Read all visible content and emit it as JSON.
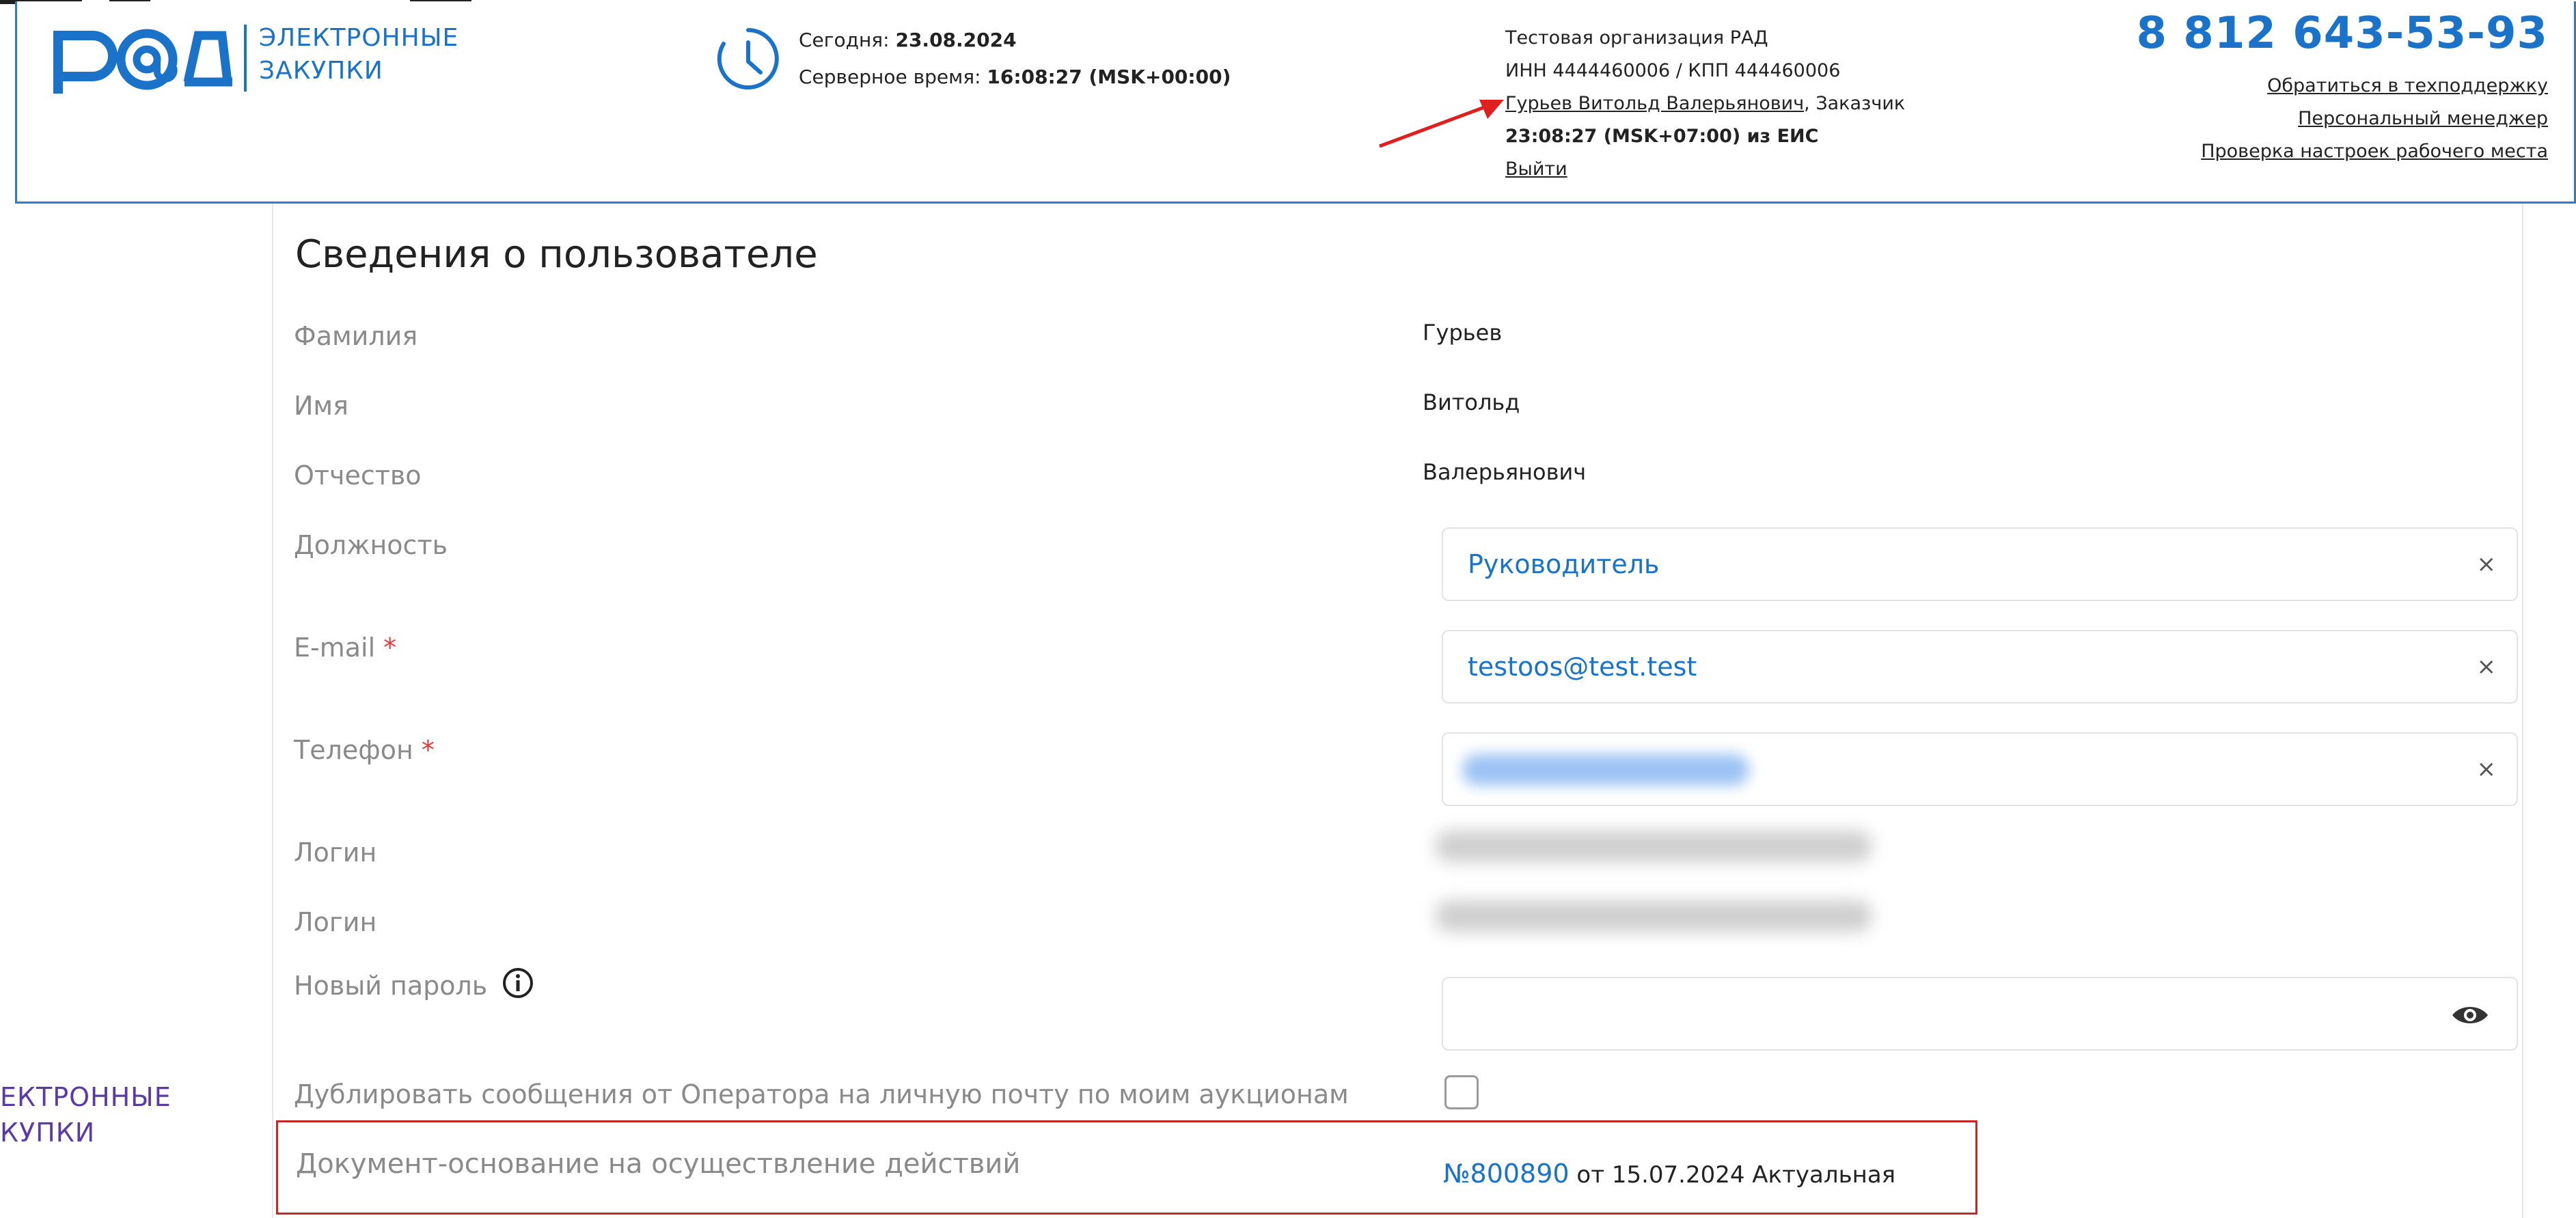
{
  "header": {
    "brand": {
      "logo_text": "РАД",
      "line1": "ЭЛЕКТРОННЫЕ",
      "line2": "ЗАКУПКИ"
    },
    "server": {
      "today_label": "Сегодня: ",
      "today_value": "23.08.2024",
      "server_label": "Серверное время: ",
      "server_value": "16:08:27 (MSK+00:00)"
    },
    "org": {
      "name": "Тестовая организация РАД",
      "inn_kpp": "ИНН 4444460006 / КПП 444460006",
      "user_link": "Гурьев Витольд Валерьянович",
      "user_role": ", Заказчик",
      "eis_time": "23:08:27 (MSK+07:00) из ЕИС",
      "logout": "Выйти"
    },
    "phone": "8 812 643-53-93",
    "links": {
      "support": "Обратиться в техподдержку",
      "manager": "Персональный менеджер",
      "check": "Проверка настроек рабочего места"
    }
  },
  "left_fragment": {
    "line1": "ЕКТРОННЫЕ",
    "line2": "КУПКИ"
  },
  "card": {
    "title": "Сведения о пользователе",
    "rows": {
      "surname": {
        "label": "Фамилия",
        "value": "Гурьев"
      },
      "name": {
        "label": "Имя",
        "value": "Витольд"
      },
      "patronymic": {
        "label": "Отчество",
        "value": "Валерьянович"
      },
      "position": {
        "label": "Должность",
        "value": "Руководитель"
      },
      "email": {
        "label": "E-mail",
        "value": "testoos@test.test"
      },
      "phone": {
        "label": "Телефон"
      },
      "login1": {
        "label": "Логин"
      },
      "login2": {
        "label": "Логин"
      },
      "new_password": {
        "label": "Новый пароль"
      },
      "duplicate": {
        "label": "Дублировать сообщения от Оператора на личную почту по моим аукционам",
        "checked": false
      },
      "document": {
        "label": "Документ-основание на осуществление действий",
        "number": "№800890",
        "rest": " от 15.07.2024 Актуальная"
      }
    },
    "required_mark": "*",
    "clear_glyph": "×"
  },
  "colors": {
    "accent": "#1a73c8",
    "highlight_border": "#c62828",
    "arrow": "#e02020",
    "required": "#e53935"
  }
}
